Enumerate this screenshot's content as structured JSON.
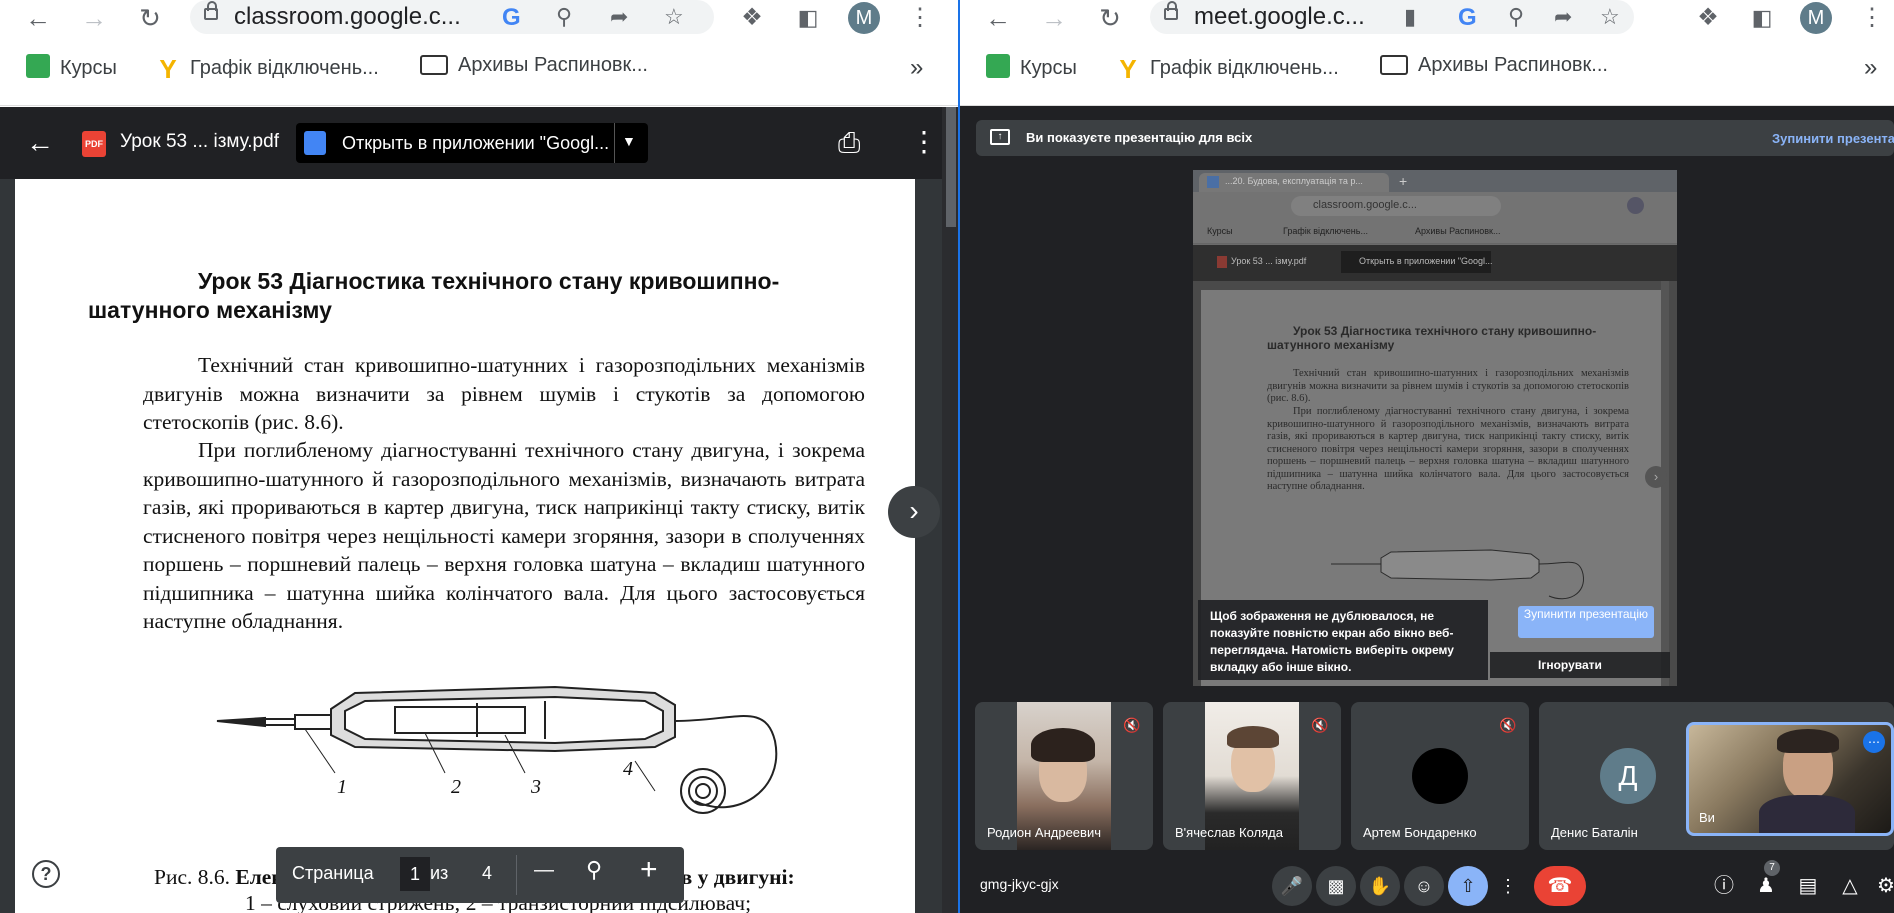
{
  "left_window": {
    "url": "classroom.google.c...",
    "bookmarks": [
      "Курсы",
      "Графік відключень...",
      "Архивы Распиновк..."
    ],
    "bookmarks_more": "»",
    "avatar": "M",
    "pdf_toolbar": {
      "file_badge": "PDF",
      "file_name": "Урок 53 ... ізму.pdf",
      "open_in_app": "Открыть в приложении \"Googl..."
    },
    "document": {
      "title_line1": "Урок 53 Діагностика технічного стану кривошипно-",
      "title_line2": "шатунного механізму",
      "paragraph1": "Технічний стан кривошипно-шатунних і газорозподільних механізмів двигунів можна визначити за рівнем шумів і стукотів за допомогою стетоскопів (рис. 8.6).",
      "paragraph2": "При поглибленому діагностуванні технічного стану двигуна, і зокрема кривошипно-шатунного й газорозподільного механізмів, визначають витрата газів, які прориваються в картер двигуна, тиск наприкінці такту стиску, витік стисненого повітря через нещільності камери згоряння, зазори в сполученнях поршень – поршневий палець – верхня головка шатуна – вкладиш шатунного підшипника – шатунна шийка колінчатого вала. Для цього застосовується наступне обладнання.",
      "figure_labels": [
        "1",
        "2",
        "3",
        "4"
      ],
      "caption_start": "Рис. 8.6.",
      "caption_bold": "Електростетоскоп для прослуховування шумів у двигуні:",
      "caption_line2": "1 – слуховий стрижень; 2 – транзисторний підсилювач;"
    },
    "page_controls": {
      "label": "Страница",
      "current": "1",
      "of": "из",
      "total": "4",
      "minus": "—",
      "plus": "+"
    },
    "help": "?"
  },
  "right_window": {
    "url": "meet.google.c...",
    "bookmarks": [
      "Курсы",
      "Графік відключень...",
      "Архивы Распиновк..."
    ],
    "bookmarks_more": "»",
    "avatar": "M",
    "banner_text": "Ви показуєте презентацію для всіх",
    "stop_link": "Зупинити презентацію",
    "warning_text": "Щоб зображення не дублювалося, не показуйте повністю екран або вікно веб-переглядача. Натомість виберіть окрему вкладку або інше вікно.",
    "stop_button": "Зупинити презентацію",
    "ignore_button": "Ігнорувати",
    "mini": {
      "tab_title": "...20. Будова, експлуатація та р...",
      "url": "classroom.google.c...",
      "bookmarks": [
        "Курсы",
        "Графік відключень...",
        "Архивы Распиновк..."
      ],
      "file_name": "Урок 53 ... ізму.pdf",
      "open_in_app": "Открыть в приложении \"Googl...",
      "title": "Урок 53 Діагностика технічного стану кривошипно-шатунного механізму",
      "para1": "Технічний стан кривошипно-шатунних і газорозподільних механізмів двигунів можна визначити за рівнем шумів і стукотів за допомогою стетоскопів (рис. 8.6).",
      "para2": "При поглибленому діагностуванні технічного стану двигуна, і зокрема кривошипно-шатунного й газорозподільного механізмів, визначають витрата газів, які прориваються в картер двигуна, тиск наприкінці такту стиску, витік стисненого повітря через нещільності камери згоряння, зазори в сполученнях поршень – поршневий палець – верхня головка шатуна – вкладиш шатунного підшипника – шатунна шийка колінчатого вала. Для цього застосовується наступне обладнання."
    },
    "participants": [
      {
        "name": "Родион Андреевич",
        "type": "video"
      },
      {
        "name": "В'ячеслав Коляда",
        "type": "video"
      },
      {
        "name": "Артем Бондаренко",
        "type": "avatar",
        "initial": ""
      },
      {
        "name": "Денис Баталін",
        "type": "avatar",
        "initial": "Д"
      },
      {
        "name": "Ви",
        "type": "video"
      }
    ],
    "meeting_code": "gmg-jkyc-gjx",
    "people_count": "7",
    "colors": {
      "meet_bg": "#202124",
      "tile_bg": "#3c4043",
      "accent_blue": "#8ab4f8",
      "end_call_red": "#ea4335",
      "present_active": "#8ab4f8"
    }
  }
}
